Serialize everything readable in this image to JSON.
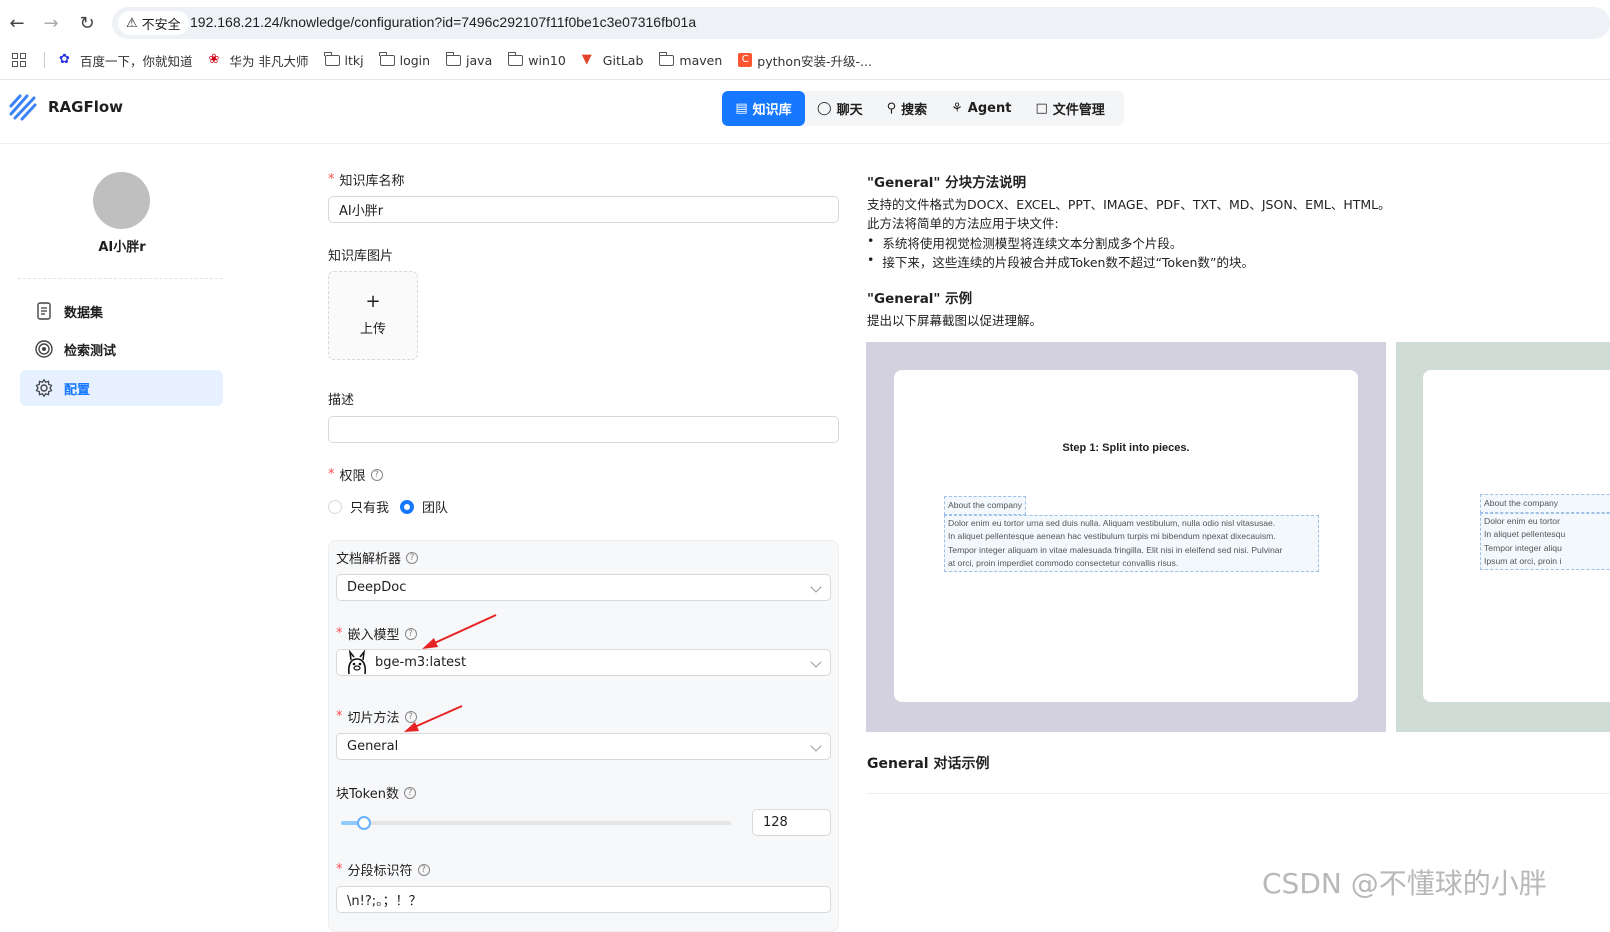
{
  "browser": {
    "insecure_label": "不安全",
    "url": "192.168.21.24/knowledge/configuration?id=7496c292107f11f0be1c3e07316fb01a",
    "bookmarks": [
      {
        "label": "百度一下，你就知道",
        "icon": "baidu-icon"
      },
      {
        "label": "华为 非凡大师",
        "icon": "huawei-icon"
      },
      {
        "label": "ltkj",
        "icon": "folder-icon"
      },
      {
        "label": "login",
        "icon": "folder-icon"
      },
      {
        "label": "java",
        "icon": "folder-icon"
      },
      {
        "label": "win10",
        "icon": "folder-icon"
      },
      {
        "label": "GitLab",
        "icon": "gitlab-icon"
      },
      {
        "label": "maven",
        "icon": "folder-icon"
      },
      {
        "label": "python安装-升级-...",
        "icon": "csdn-icon"
      }
    ]
  },
  "app": {
    "brand": "RAGFlow",
    "nav": [
      "知识库",
      "聊天",
      "搜索",
      "Agent",
      "文件管理"
    ],
    "accent": "#1677ff"
  },
  "sidebar": {
    "kb_name": "AI小胖r",
    "items": [
      "数据集",
      "检索测试",
      "配置"
    ]
  },
  "form": {
    "name_label": "知识库名称",
    "name_value": "AI小胖r",
    "image_label": "知识库图片",
    "upload_label": "上传",
    "desc_label": "描述",
    "desc_value": "",
    "permission_label": "权限",
    "perm_options": [
      "只有我",
      "团队"
    ],
    "perm_selected": "团队",
    "parser_label": "文档解析器",
    "parser_value": "DeepDoc",
    "embed_label": "嵌入模型",
    "embed_value": "bge-m3:latest",
    "chunk_label": "切片方法",
    "chunk_value": "General",
    "token_label": "块Token数",
    "token_value": "128",
    "token_fraction": 0.06,
    "delim_label": "分段标识符",
    "delim_value": "\\n!?;。；！？"
  },
  "info": {
    "title": "\"General\" 分块方法说明",
    "formats": "支持的文件格式为DOCX、EXCEL、PPT、IMAGE、PDF、TXT、MD、JSON、EML、HTML。",
    "intro": "此方法将简单的方法应用于块文件:",
    "bullets": [
      "系统将使用视觉检测模型将连续文本分割成多个片段。",
      "接下来，这些连续的片段被合并成Token数不超过“Token数”的块。"
    ],
    "example_title": "\"General\" 示例",
    "example_desc": "提出以下屏幕截图以促进理解。",
    "example_step": "Step 1: Split into pieces.",
    "example_heading": "About the company",
    "example_lines": [
      "Dolor enim eu tortor urna sed duis nulla. Aliquam vestibulum, nulla odio nisl vitasusae.",
      "In aliquet pellentesque aenean hac vestibulum turpis mi bibendum npexat dixecauism.",
      "Tempor integer aliquam in vitae malesuada fringilla. Elit nisi in eleifend sed nisi. Pulvinar",
      "at orci, proin imperdiet commodo consectetur convallis risus."
    ],
    "example2_heading": "About the company",
    "example2_lines": [
      "Dolor enim eu tortor",
      "In aliquet pellentesqu",
      "Tempor integer aliqu",
      "Ipsum at orci, proin i"
    ],
    "conversation_title": "General 对话示例"
  },
  "watermark": "CSDN @不懂球的小胖"
}
